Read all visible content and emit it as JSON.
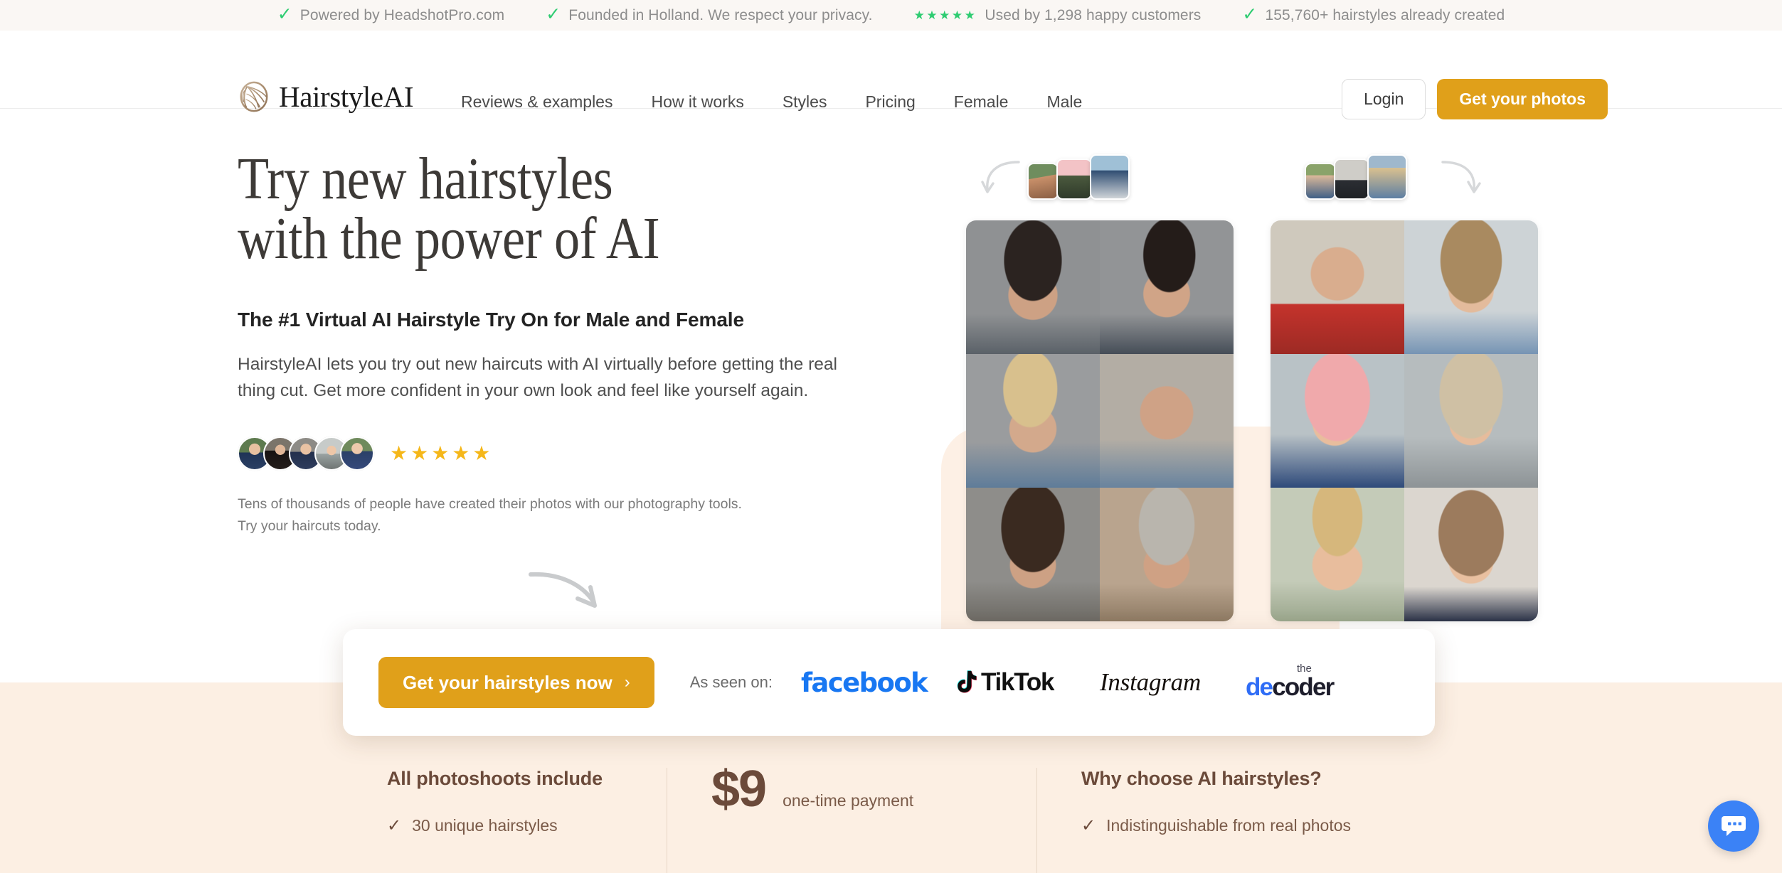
{
  "announcement_bar": {
    "items": [
      {
        "icon": "check-icon",
        "text": "Powered by HeadshotPro.com"
      },
      {
        "icon": "check-icon",
        "text": "Founded in Holland. We respect your privacy."
      },
      {
        "icon": "stars-icon",
        "stars": "★★★★★",
        "text": "Used by 1,298 happy customers"
      },
      {
        "icon": "check-icon",
        "text": "155,760+ hairstyles already created"
      }
    ],
    "check_glyph": "✓",
    "background": "#faf7f4",
    "check_color": "#2ecc71"
  },
  "header": {
    "brand": {
      "logo_icon": "hairstyle-logo-icon",
      "name": "HairstyleAI"
    },
    "nav": [
      {
        "label": "Reviews & examples"
      },
      {
        "label": "How it works"
      },
      {
        "label": "Styles"
      },
      {
        "label": "Pricing"
      },
      {
        "label": "Female"
      },
      {
        "label": "Male"
      }
    ],
    "login_label": "Login",
    "cta_label": "Get your photos",
    "accent_color": "#e0a01a"
  },
  "hero": {
    "heading_line1": "Try new hairstyles",
    "heading_line2": "with the power of AI",
    "subheading": "The #1 Virtual AI Hairstyle Try On for Male and Female",
    "body": "HairstyleAI lets you try out new haircuts with AI virtually before getting the real thing cut. Get more confident in your own look and feel like yourself again.",
    "rating_stars": "★★★★★",
    "rating_star_color": "#f5b719",
    "avatar_count": 5,
    "note": "Tens of thousands of people have created their photos with our photography tools. Try your haircuts today.",
    "decorative_arrow_icon": "curved-arrow-icon"
  },
  "cta_card": {
    "button_label": "Get your hairstyles now",
    "button_chevron": "›",
    "seen_on_label": "As seen on:",
    "logos": [
      {
        "name": "facebook-logo",
        "text": "facebook"
      },
      {
        "name": "tiktok-logo",
        "text": "TikTok"
      },
      {
        "name": "instagram-logo",
        "text": "Instagram"
      },
      {
        "name": "decoder-logo",
        "text_small": "the",
        "text_blue": "de",
        "text_dark": "coder"
      }
    ]
  },
  "feature_bar": {
    "background": "#fcefe3",
    "columns": [
      {
        "title": "All photoshoots include",
        "items": [
          "30 unique hairstyles"
        ],
        "check_glyph": "✓"
      },
      {
        "price": "$9",
        "price_note": "one-time payment"
      },
      {
        "title": "Why choose AI hairstyles?",
        "items": [
          "Indistinguishable from real photos"
        ],
        "check_glyph": "✓"
      }
    ]
  },
  "chat_widget": {
    "icon": "chat-bubble-icon",
    "color": "#3b82f6"
  }
}
